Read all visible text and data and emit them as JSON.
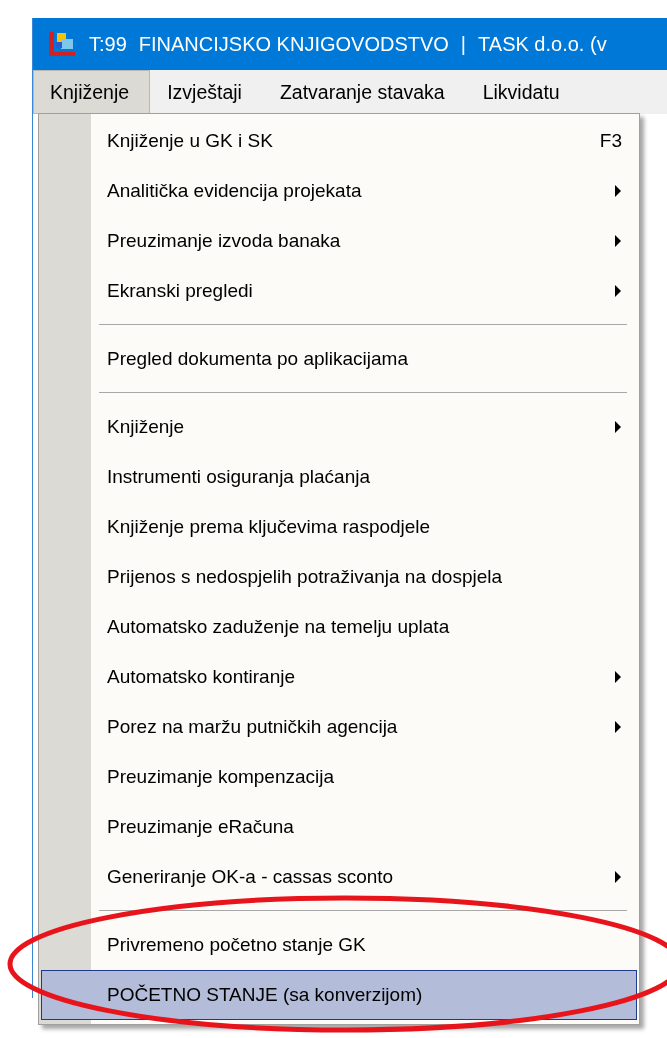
{
  "window": {
    "title_parts": [
      "T:99",
      "FINANCIJSKO KNJIGOVODSTVO",
      "|",
      "TASK d.o.o. (v"
    ]
  },
  "menu_bar": [
    {
      "label": "Knjiženje",
      "selected": true
    },
    {
      "label": "Izvještaji",
      "selected": false
    },
    {
      "label": "Zatvaranje stavaka",
      "selected": false
    },
    {
      "label": "Likvidatu",
      "selected": false
    }
  ],
  "dropdown": [
    {
      "kind": "item",
      "label": "Knjiženje u GK i SK",
      "shortcut": "F3",
      "submenu": false,
      "selected": false
    },
    {
      "kind": "item",
      "label": "Analitička evidencija projekata",
      "submenu": true,
      "selected": false
    },
    {
      "kind": "item",
      "label": "Preuzimanje izvoda banaka",
      "submenu": true,
      "selected": false
    },
    {
      "kind": "item",
      "label": "Ekranski pregledi",
      "submenu": true,
      "selected": false
    },
    {
      "kind": "separator"
    },
    {
      "kind": "item",
      "label": "Pregled dokumenta po aplikacijama",
      "submenu": false,
      "selected": false
    },
    {
      "kind": "separator"
    },
    {
      "kind": "item",
      "label": "Knjiženje",
      "submenu": true,
      "selected": false
    },
    {
      "kind": "item",
      "label": "Instrumenti osiguranja  plaćanja",
      "submenu": false,
      "selected": false
    },
    {
      "kind": "item",
      "label": "Knjiženje prema ključevima raspodjele",
      "submenu": false,
      "selected": false
    },
    {
      "kind": "item",
      "label": "Prijenos s nedospjelih potraživanja na dospjela",
      "submenu": false,
      "selected": false
    },
    {
      "kind": "item",
      "label": "Automatsko zaduženje na temelju uplata",
      "submenu": false,
      "selected": false
    },
    {
      "kind": "item",
      "label": "Automatsko kontiranje",
      "submenu": true,
      "selected": false
    },
    {
      "kind": "item",
      "label": "Porez na maržu putničkih agencija",
      "submenu": true,
      "selected": false
    },
    {
      "kind": "item",
      "label": "Preuzimanje kompenzacija",
      "submenu": false,
      "selected": false
    },
    {
      "kind": "item",
      "label": "Preuzimanje eRačuna",
      "submenu": false,
      "selected": false
    },
    {
      "kind": "item",
      "label": "Generiranje OK-a - cassas sconto",
      "submenu": true,
      "selected": false
    },
    {
      "kind": "separator"
    },
    {
      "kind": "item",
      "label": "Privremeno početno stanje GK",
      "submenu": false,
      "selected": false
    },
    {
      "kind": "item",
      "label": "POČETNO STANJE (sa konverzijom)",
      "submenu": false,
      "selected": true
    }
  ]
}
